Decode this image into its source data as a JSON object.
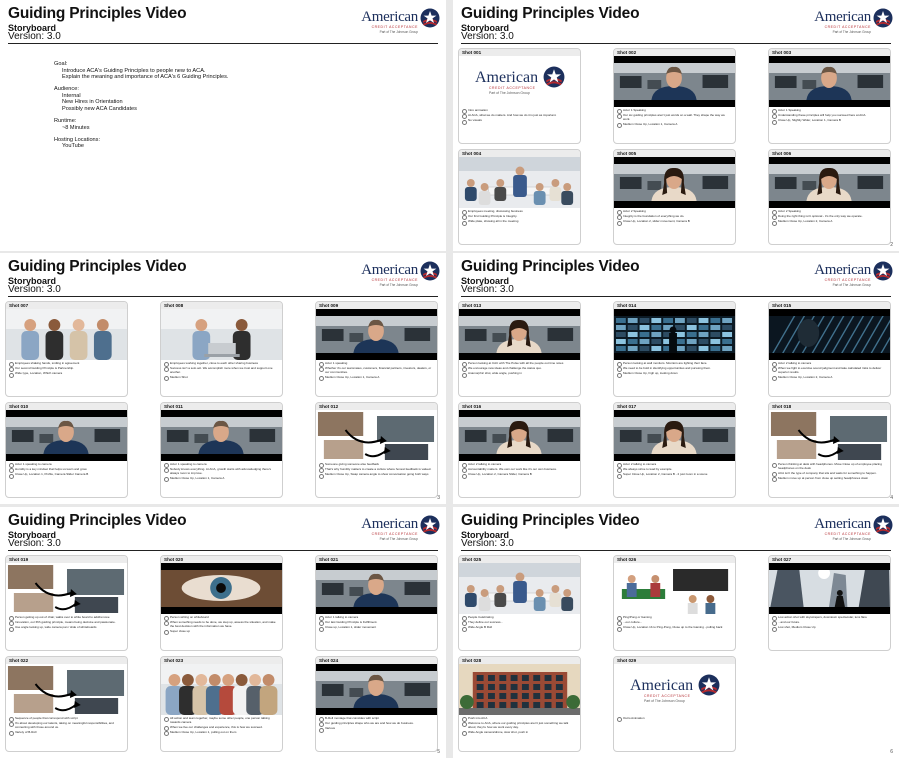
{
  "doc": {
    "title": "Guiding Principles Video",
    "subtitle": "Storyboard",
    "version": "Version: 3.0"
  },
  "logo": {
    "wordmark": "American",
    "tagline": "CREDIT ACCEPTANCE",
    "parent": "Part of The Johnson Group"
  },
  "colors": {
    "navy": "#1c2f5c",
    "red": "#b3292e"
  },
  "intro": [
    {
      "heading": "Goal:",
      "lines": [
        "Introduce ACA's Guiding Principles to people new to ACA.",
        "Explain the meaning and importance of ACA's 6 Guiding Principles."
      ]
    },
    {
      "heading": "Audience:",
      "lines": [
        "Internal",
        "New Hires in Orientation",
        "Possibly new ACA Candidates"
      ]
    },
    {
      "heading": "Runtime:",
      "lines": [
        "~8 Minutes"
      ]
    },
    {
      "heading": "Hosting Locations:",
      "lines": [
        "YouTube"
      ]
    }
  ],
  "page_numbers": [
    "",
    "2",
    "3",
    "4",
    "5",
    "6"
  ],
  "shots": [
    {
      "label": "Shot 001",
      "scene": "logo",
      "notes": [
        "Intro animation",
        "At ACA, what we do matters. And how we do it is just as important.",
        "No visuals"
      ]
    },
    {
      "label": "Shot 002",
      "scene": "office-man",
      "notes": [
        "Actor 1 Speaking",
        "Our six guiding principles aren't just words on a wall. They shape the way we work.",
        "Medium Close Up, Location 1, Camera A"
      ]
    },
    {
      "label": "Shot 003",
      "scene": "office-man",
      "notes": [
        "Actor 1 Speaking",
        "Understanding these principles will help you succeed here at ACA.",
        "Close Up, Slightly Wider, Location 1, Camera B"
      ]
    },
    {
      "label": "Shot 004",
      "scene": "meeting",
      "notes": [
        "Employees meeting, discussing business",
        "Our first Guiding Principle is Integrity.",
        "Wide plate, showing all in the meeting"
      ]
    },
    {
      "label": "Shot 005",
      "scene": "office-woman",
      "notes": [
        "Actor 2 Speaking",
        "Integrity is the foundation of everything we do.",
        "Close Up, Location 2, slider movement, Camera B"
      ]
    },
    {
      "label": "Shot 006",
      "scene": "office-woman",
      "notes": [
        "Actor 2 Speaking",
        "Doing the right thing isn't optional - it's the only way we operate.",
        "Medium Close Up, Location 2, Camera A"
      ]
    },
    {
      "label": "Shot 007",
      "scene": "group",
      "notes": [
        "Employees shaking hands, smiling in agreement",
        "Our second Guiding Principle is Partnership.",
        "Wide type, Location, Which camera"
      ]
    },
    {
      "label": "Shot 008",
      "scene": "laptop",
      "notes": [
        "Employees working together, close to each other sharing business",
        "Success isn't a solo act. We accomplish more when we trust and support one another.",
        "Medium Shot"
      ]
    },
    {
      "label": "Shot 009",
      "scene": "office-man",
      "notes": [
        "Actor 1 speaking",
        "Whether it's our teammates, customers, financial partners, investors, dealers, or our communities.",
        "Medium Close Up, Location 1, Camera A"
      ]
    },
    {
      "label": "Shot 010",
      "scene": "office-man",
      "notes": [
        "Actor 1 speaking to camera",
        "Humility is a key mindset that helps us learn and grow.",
        "Close Up, Location 1, Profile, Camera Slider Camera B"
      ]
    },
    {
      "label": "Shot 011",
      "scene": "office-man",
      "notes": [
        "Actor 1 speaking to camera",
        "Nobody knows everything. At ACA, growth starts with acknowledging there's always room to improve.",
        "Medium Close Up, Location 1, Camera A"
      ]
    },
    {
      "label": "Shot 012",
      "scene": "collage",
      "notes": [
        "Someone giving someone else feedback",
        "That's why humility matters to create a culture where honest feedback is valued.",
        "Medium Close Up, Swap camera angle to show conversation going both ways"
      ]
    },
    {
      "label": "Shot 013",
      "scene": "office-woman",
      "notes": [
        "Person looking at CAC with The Pulse with all the people out time notes",
        "We encourage new ideas and challenge the status quo.",
        "Anamorphic shot, wide angle, pushing in"
      ]
    },
    {
      "label": "Shot 014",
      "scene": "datawall",
      "notes": [
        "Person looking at wall monitors. Monitors are lighting their face.",
        "We need to be bold in identifying opportunities and pursuing them.",
        "Medium Close Up, high up, looking down"
      ]
    },
    {
      "label": "Shot 015",
      "scene": "abstract",
      "notes": [
        "Actor 2 talking to camera",
        "When we fight to exercise sound judgment and take calculated risks to deliver superior results.",
        "Medium Close Up, Location 2, Camera A"
      ]
    },
    {
      "label": "Shot 016",
      "scene": "office-woman",
      "notes": [
        "Actor 2 talking to camera",
        "Accountability matters. We own our work like it's our own business.",
        "Close Up, Location 2, Camera Slider, Camera B"
      ]
    },
    {
      "label": "Shot 017",
      "scene": "office-woman",
      "notes": [
        "Actor 2 talking to camera",
        "We always strive to lead by example.",
        "Super Close Up, Location 2, Camera B - 2 just zoom in a scene"
      ]
    },
    {
      "label": "Shot 018",
      "scene": "collage",
      "notes": [
        "Person thinking at desk with headphones. Move Close up of employee placing headphones on the desk",
        "ACA isn't the type of company that sits and waits for something to happen.",
        "Medium move up at person from close up setting headphones down"
      ]
    },
    {
      "label": "Shot 019",
      "scene": "collage",
      "notes": [
        "Person getting up out of chair, walks over to white board to add/remove",
        "Innovation, our fifth guiding principle, means being decisive and passionate.",
        "Use angle looking up, wide camera pan / slide of whiteboards"
      ]
    },
    {
      "label": "Shot 020",
      "scene": "eye",
      "notes": [
        "Person writing on whiteboard",
        "When something needs to be done, we step up, assess the situation, and make the best decision with the information we have.",
        "Super close up"
      ]
    },
    {
      "label": "Shot 021",
      "scene": "office-man",
      "notes": [
        "Actor 1 talking to camera",
        "Our last Guiding Principle is Fulfillment.",
        "Close up, Location 1, slider movement"
      ]
    },
    {
      "label": "Shot 022",
      "scene": "collage",
      "notes": [
        "Sequence of people that correspond with script",
        "It's about developing our talents, taking on meaningful responsibilities, and connecting with those around us.",
        "Variety of B-Roll"
      ]
    },
    {
      "label": "Shot 023",
      "scene": "crowd",
      "notes": [
        "All action and team together, maybe some other people, one person talking towards camera",
        "When we live our challenges and experience, this is how we succeed.",
        "Medium Close Up, Location 1, pulling out on them"
      ]
    },
    {
      "label": "Shot 024",
      "scene": "office-man",
      "notes": [
        "B-Roll montage that coincides with script",
        "Our guiding principles shape who we are and how we do business.",
        "Various"
      ]
    },
    {
      "label": "Shot 025",
      "scene": "meeting",
      "notes": [
        "People Celebrating",
        "They define our success...",
        "Wide Angle B Roll"
      ]
    },
    {
      "label": "Shot 026",
      "scene": "pingpong",
      "notes": [
        "Ping/Pong or Gaming",
        "...our culture...",
        "Close Up, Location 1b to Ping-Pong, Close up to the Gaming - pulling back"
      ]
    },
    {
      "label": "Shot 027",
      "scene": "skyline",
      "notes": [
        "Low action shot with skyscrapers, downtown spectacular, lens flare",
        "...and our future.",
        "Low shot, Medium Close Up"
      ]
    },
    {
      "label": "Shot 028",
      "scene": "building",
      "notes": [
        "Push into ACA",
        "Welcome to ACA, where our guiding principles aren't just something we talk about; they're how we work every day.",
        "Wide Angle camera/drone, slow shot, push in"
      ]
    },
    {
      "label": "Shot 029",
      "scene": "logo",
      "notes": [
        "Outro Animation"
      ]
    }
  ]
}
